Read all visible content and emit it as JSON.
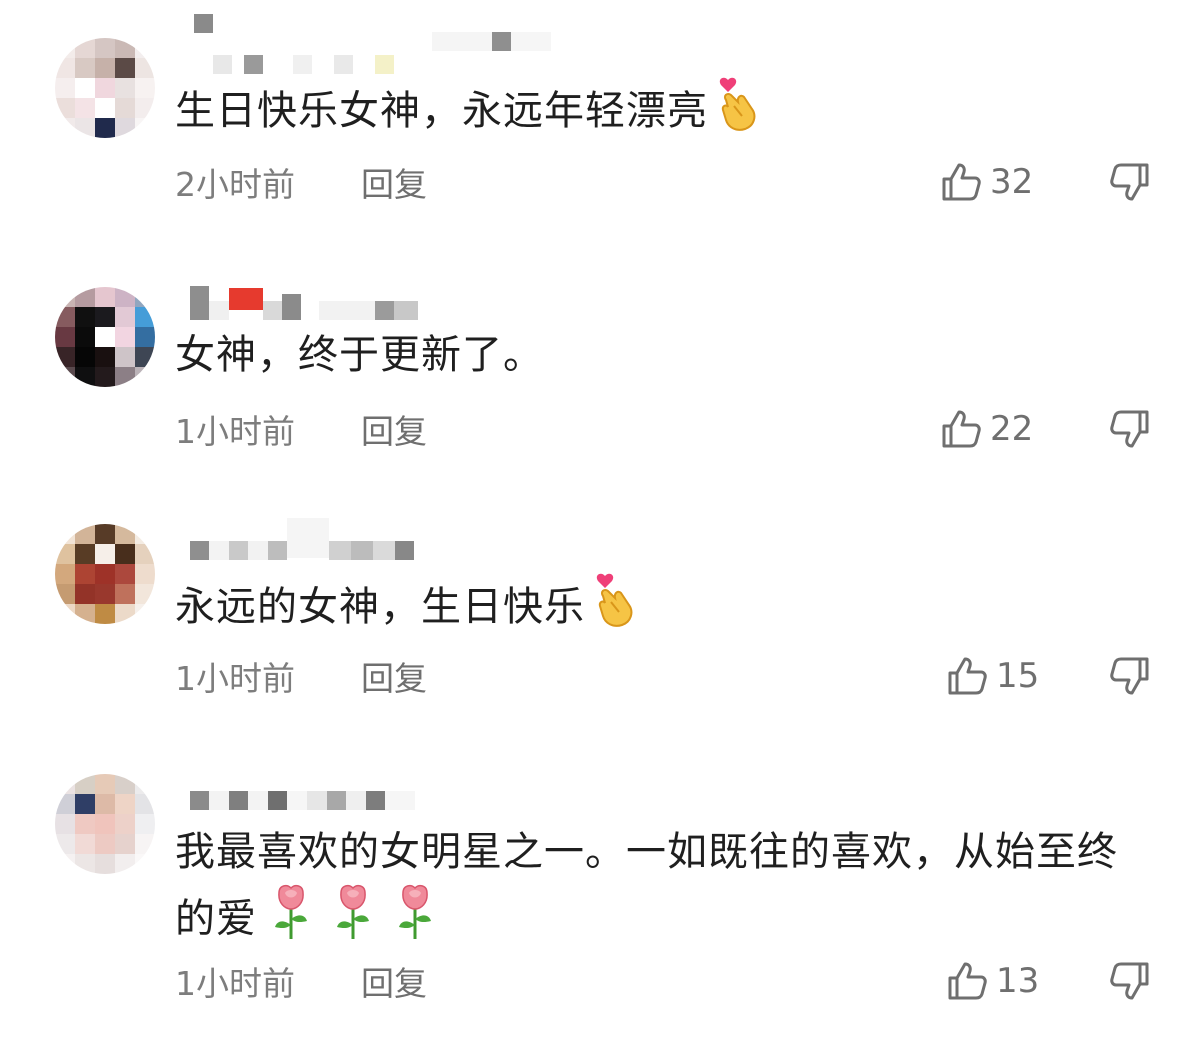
{
  "comments": [
    {
      "text": "生日快乐女神，永远年轻漂亮",
      "emojis": [
        "finger-heart-icon"
      ],
      "time": "2小时前",
      "reply": "回复",
      "likes": "32"
    },
    {
      "text": "女神，终于更新了。",
      "emojis": [],
      "time": "1小时前",
      "reply": "回复",
      "likes": "22"
    },
    {
      "text": "永远的女神，生日快乐",
      "emojis": [
        "finger-heart-icon"
      ],
      "time": "1小时前",
      "reply": "回复",
      "likes": "15"
    },
    {
      "text": "我最喜欢的女明星之一。一如既往的喜欢，从始至终的爱",
      "emojis": [
        "rose-icon",
        "rose-icon",
        "rose-icon"
      ],
      "time": "1小时前",
      "reply": "回复",
      "likes": "13"
    }
  ],
  "colors": {
    "text": "#1f1f1f",
    "meta": "#7d7d7d",
    "icon": "#6f6f6f"
  }
}
